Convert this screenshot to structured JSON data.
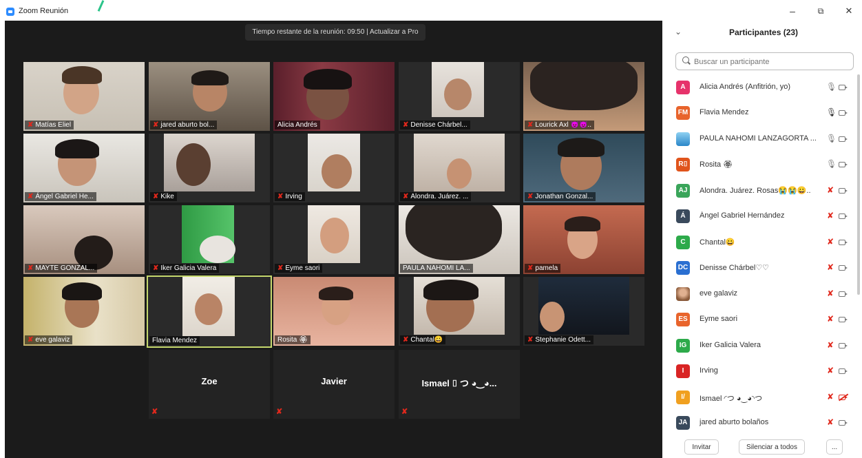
{
  "window": {
    "title": "Zoom Reunión",
    "controls": {
      "minimize": "–",
      "maximize": "⧉",
      "close": "✕"
    }
  },
  "meeting": {
    "banner": "Tiempo restante de la reunión: 09:50 | Actualizar a Pro"
  },
  "tiles": [
    {
      "label": "Matías Eliel",
      "muted": true
    },
    {
      "label": "jared aburto bol...",
      "muted": true
    },
    {
      "label": "Alicia Andrés",
      "muted": false
    },
    {
      "label": "Denisse Chárbel...",
      "muted": true
    },
    {
      "label": "Lourick Axl 😈😈..",
      "muted": true
    },
    {
      "label": "Ángel Gabriel He...",
      "muted": true
    },
    {
      "label": "Kike",
      "muted": true
    },
    {
      "label": "Irving",
      "muted": true
    },
    {
      "label": "Alondra. Juárez. ...",
      "muted": true
    },
    {
      "label": "Jonathan Gonzal...",
      "muted": true
    },
    {
      "label": "MAYTE GONZAL...",
      "muted": true
    },
    {
      "label": "Iker Galicia Valera",
      "muted": true
    },
    {
      "label": "Eyme saori",
      "muted": true
    },
    {
      "label": "PAULA NAHOMI LA...",
      "muted": false
    },
    {
      "label": "pamela",
      "muted": true
    },
    {
      "label": "eve galaviz",
      "muted": true
    },
    {
      "label": "Flavia Mendez",
      "muted": false
    },
    {
      "label": "Rosita 🏵",
      "muted": false
    },
    {
      "label": "Chantal😀",
      "muted": true
    },
    {
      "label": "Stephanie Odett...",
      "muted": true
    }
  ],
  "name_tiles": [
    {
      "name": "Zoe"
    },
    {
      "name": "Javier"
    },
    {
      "name": "Ismael ⌷ つ ◕‿◕..."
    }
  ],
  "panel": {
    "title": "Participantes (23)",
    "search_placeholder": "Buscar un participante",
    "participants": [
      {
        "initials": "A",
        "color": "#e6336b",
        "name": "Alicia Andrés (Anfitrión, yo)",
        "mic": "on",
        "cam": "on"
      },
      {
        "initials": "FM",
        "color": "#e8642c",
        "name": "Flavia Mendez",
        "mic": "speaking",
        "cam": "on"
      },
      {
        "initials": "",
        "color": "#3a9ad9",
        "name": "PAULA NAHOMI LANZAGORTA ...",
        "mic": "on",
        "cam": "on",
        "picture": true
      },
      {
        "initials": "R⌷",
        "color": "#e0541c",
        "name": "Rosita 🏵",
        "mic": "on",
        "cam": "on"
      },
      {
        "initials": "AJ",
        "color": "#3aa55a",
        "name": "Alondra. Juárez. Rosas😭😭😀..",
        "mic": "off",
        "cam": "on"
      },
      {
        "initials": "Á",
        "color": "#3a4a5c",
        "name": "Ángel Gabriel Hernández",
        "mic": "off",
        "cam": "on"
      },
      {
        "initials": "C",
        "color": "#2daa4a",
        "name": "Chantal😀",
        "mic": "off",
        "cam": "on"
      },
      {
        "initials": "DC",
        "color": "#2a6fd1",
        "name": "Denisse Chárbel♡♡",
        "mic": "off",
        "cam": "on"
      },
      {
        "initials": "",
        "color": "#b77a55",
        "name": "eve galaviz",
        "mic": "off",
        "cam": "on",
        "picture": true
      },
      {
        "initials": "ES",
        "color": "#e8642c",
        "name": "Eyme saori",
        "mic": "off",
        "cam": "on"
      },
      {
        "initials": "IG",
        "color": "#2daa4a",
        "name": "Iker Galicia Valera",
        "mic": "off",
        "cam": "on"
      },
      {
        "initials": "I",
        "color": "#d92424",
        "name": "Irving",
        "mic": "off",
        "cam": "on"
      },
      {
        "initials": "I/",
        "color": "#f0a020",
        "name": "Ismael ◜つ ◕‿◕◝つ",
        "mic": "off",
        "cam": "off"
      },
      {
        "initials": "JA",
        "color": "#3a4a5c",
        "name": "jared aburto bolaños",
        "mic": "off",
        "cam": "on"
      }
    ],
    "invite_label": "Invitar",
    "mute_all_label": "Silenciar a todos",
    "more_label": "..."
  },
  "colors": {
    "active_speaker_border": "#c5d86d",
    "muted_red": "#e0281c",
    "video_bg": "#1b1b1b"
  }
}
